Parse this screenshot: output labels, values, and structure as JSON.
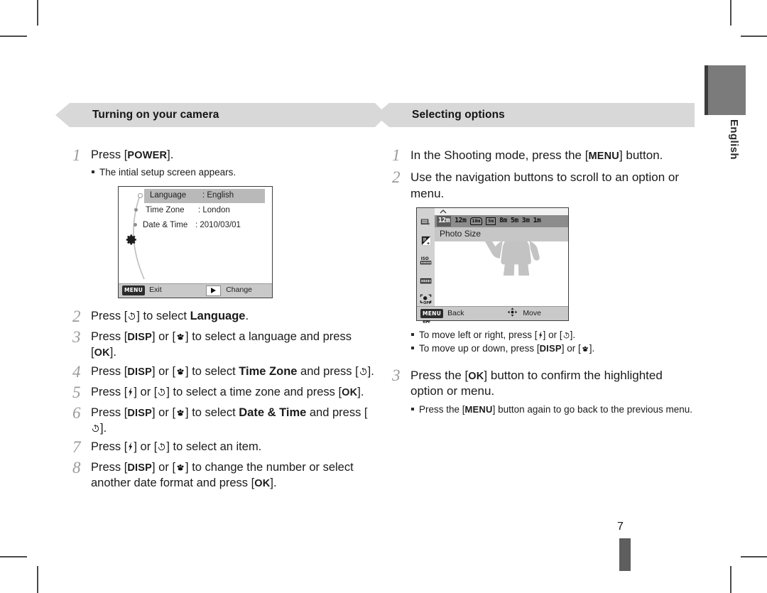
{
  "page": {
    "number": "7",
    "language_tab": "English"
  },
  "left_column": {
    "header": {
      "title": "Turning on your camera",
      "marker_icon": "triangle-right-icon"
    },
    "steps": [
      {
        "num": "1",
        "text_parts": [
          {
            "t": "Press ["
          },
          {
            "t": "POWER",
            "style": "key"
          },
          {
            "t": "]."
          }
        ],
        "bullets": [
          "The intial setup screen appears."
        ]
      },
      {
        "num": "2",
        "text_parts": [
          {
            "t": "Press ["
          },
          {
            "t": "self-timer-icon",
            "style": "icon"
          },
          {
            "t": "] to select "
          },
          {
            "t": "Language",
            "style": "bold"
          },
          {
            "t": "."
          }
        ]
      },
      {
        "num": "3",
        "text_parts": [
          {
            "t": "Press ["
          },
          {
            "t": "DISP",
            "style": "key"
          },
          {
            "t": "] or ["
          },
          {
            "t": "macro-icon",
            "style": "icon"
          },
          {
            "t": "] to select a language and press ["
          },
          {
            "t": "OK",
            "style": "key"
          },
          {
            "t": "]."
          }
        ]
      },
      {
        "num": "4",
        "text_parts": [
          {
            "t": "Press ["
          },
          {
            "t": "DISP",
            "style": "key"
          },
          {
            "t": "] or ["
          },
          {
            "t": "macro-icon",
            "style": "icon"
          },
          {
            "t": "] to select "
          },
          {
            "t": "Time Zone",
            "style": "bold"
          },
          {
            "t": " and press ["
          },
          {
            "t": "self-timer-icon",
            "style": "icon"
          },
          {
            "t": "]."
          }
        ]
      },
      {
        "num": "5",
        "text_parts": [
          {
            "t": "Press ["
          },
          {
            "t": "flash-icon",
            "style": "icon"
          },
          {
            "t": "] or ["
          },
          {
            "t": "self-timer-icon",
            "style": "icon"
          },
          {
            "t": "] to select a time zone and press ["
          },
          {
            "t": "OK",
            "style": "key"
          },
          {
            "t": "]."
          }
        ]
      },
      {
        "num": "6",
        "text_parts": [
          {
            "t": "Press ["
          },
          {
            "t": "DISP",
            "style": "key"
          },
          {
            "t": "] or ["
          },
          {
            "t": "macro-icon",
            "style": "icon"
          },
          {
            "t": "] to select "
          },
          {
            "t": "Date & Time",
            "style": "bold"
          },
          {
            "t": " and press ["
          },
          {
            "t": "self-timer-icon",
            "style": "icon"
          },
          {
            "t": "]."
          }
        ]
      },
      {
        "num": "7",
        "text_parts": [
          {
            "t": "Press ["
          },
          {
            "t": "flash-icon",
            "style": "icon"
          },
          {
            "t": "] or ["
          },
          {
            "t": "self-timer-icon",
            "style": "icon"
          },
          {
            "t": "] to select an item."
          }
        ]
      },
      {
        "num": "8",
        "text_parts": [
          {
            "t": "Press ["
          },
          {
            "t": "DISP",
            "style": "key"
          },
          {
            "t": "] or ["
          },
          {
            "t": "macro-icon",
            "style": "icon"
          },
          {
            "t": "] to change the number or select another date format and press ["
          },
          {
            "t": "OK",
            "style": "key"
          },
          {
            "t": "]."
          }
        ]
      }
    ],
    "lcd_setup_screen": {
      "menu_icon": "gear-icon",
      "rows": [
        {
          "label": "Language",
          "value": ": English",
          "selected": true
        },
        {
          "label": "Time Zone",
          "value": ": London",
          "selected": false
        },
        {
          "label": "Date & Time",
          "value": ": 2010/03/01",
          "selected": false
        }
      ],
      "footer": {
        "left_badge": "MENU",
        "left_label": "Exit",
        "right_icon": "play-right-icon",
        "right_label": "Change"
      }
    }
  },
  "right_column": {
    "header": {
      "title": "Selecting options",
      "marker_icon": "square-marker-icon"
    },
    "steps": [
      {
        "num": "1",
        "text_parts": [
          {
            "t": "In the Shooting mode, press the ["
          },
          {
            "t": "MENU",
            "style": "key"
          },
          {
            "t": "] button."
          }
        ]
      },
      {
        "num": "2",
        "text_parts": [
          {
            "t": "Use the navigation buttons to scroll to an option or menu."
          }
        ]
      },
      {
        "num": "3",
        "text_parts": [
          {
            "t": "Press the ["
          },
          {
            "t": "OK",
            "style": "key"
          },
          {
            "t": "] button to confirm the highlighted option or menu."
          }
        ],
        "bullets_parts": [
          [
            {
              "t": "Press the ["
            },
            {
              "t": "MENU",
              "style": "key"
            },
            {
              "t": "] button again to go back to the previous menu."
            }
          ]
        ]
      }
    ],
    "move_bullets": [
      [
        {
          "t": "To move left or right, press ["
        },
        {
          "t": "flash-icon",
          "style": "icon"
        },
        {
          "t": "] or ["
        },
        {
          "t": "self-timer-icon",
          "style": "icon"
        },
        {
          "t": "]."
        }
      ],
      [
        {
          "t": "To move up or down, press ["
        },
        {
          "t": "DISP",
          "style": "key"
        },
        {
          "t": "] or ["
        },
        {
          "t": "macro-icon",
          "style": "icon"
        },
        {
          "t": "]."
        }
      ]
    ],
    "lcd_menu_screen": {
      "resolution_options": [
        {
          "label": "12m",
          "type": "text",
          "selected": true
        },
        {
          "label": "12m",
          "type": "text",
          "selected": false
        },
        {
          "label": "10m",
          "type": "boxed-wide",
          "selected": false
        },
        {
          "label": "5m",
          "type": "boxed",
          "selected": false
        },
        {
          "label": "8m",
          "type": "text",
          "selected": false
        },
        {
          "label": "5m",
          "type": "text",
          "selected": false
        },
        {
          "label": "3m",
          "type": "text",
          "selected": false
        },
        {
          "label": "1m",
          "type": "text",
          "selected": false
        }
      ],
      "side_icons": [
        "quality-icon",
        "ev-icon",
        "iso-icon",
        "white-balance-icon",
        "face-detection-off-icon",
        "smart-filter-off-icon"
      ],
      "option_label": "Photo Size",
      "footer": {
        "left_badge": "MENU",
        "left_label": "Back",
        "right_icon": "four-way-move-icon",
        "right_label": "Move"
      }
    }
  },
  "colors": {
    "header_bar": "#d8d8d8",
    "step_number": "#9a9a9a",
    "lcd_selected_row": "#b9b9b9",
    "lcd_footer": "#c9c9c9",
    "menu_topbar": "#8c8c8c",
    "lang_tab": "#7b7b7b"
  }
}
